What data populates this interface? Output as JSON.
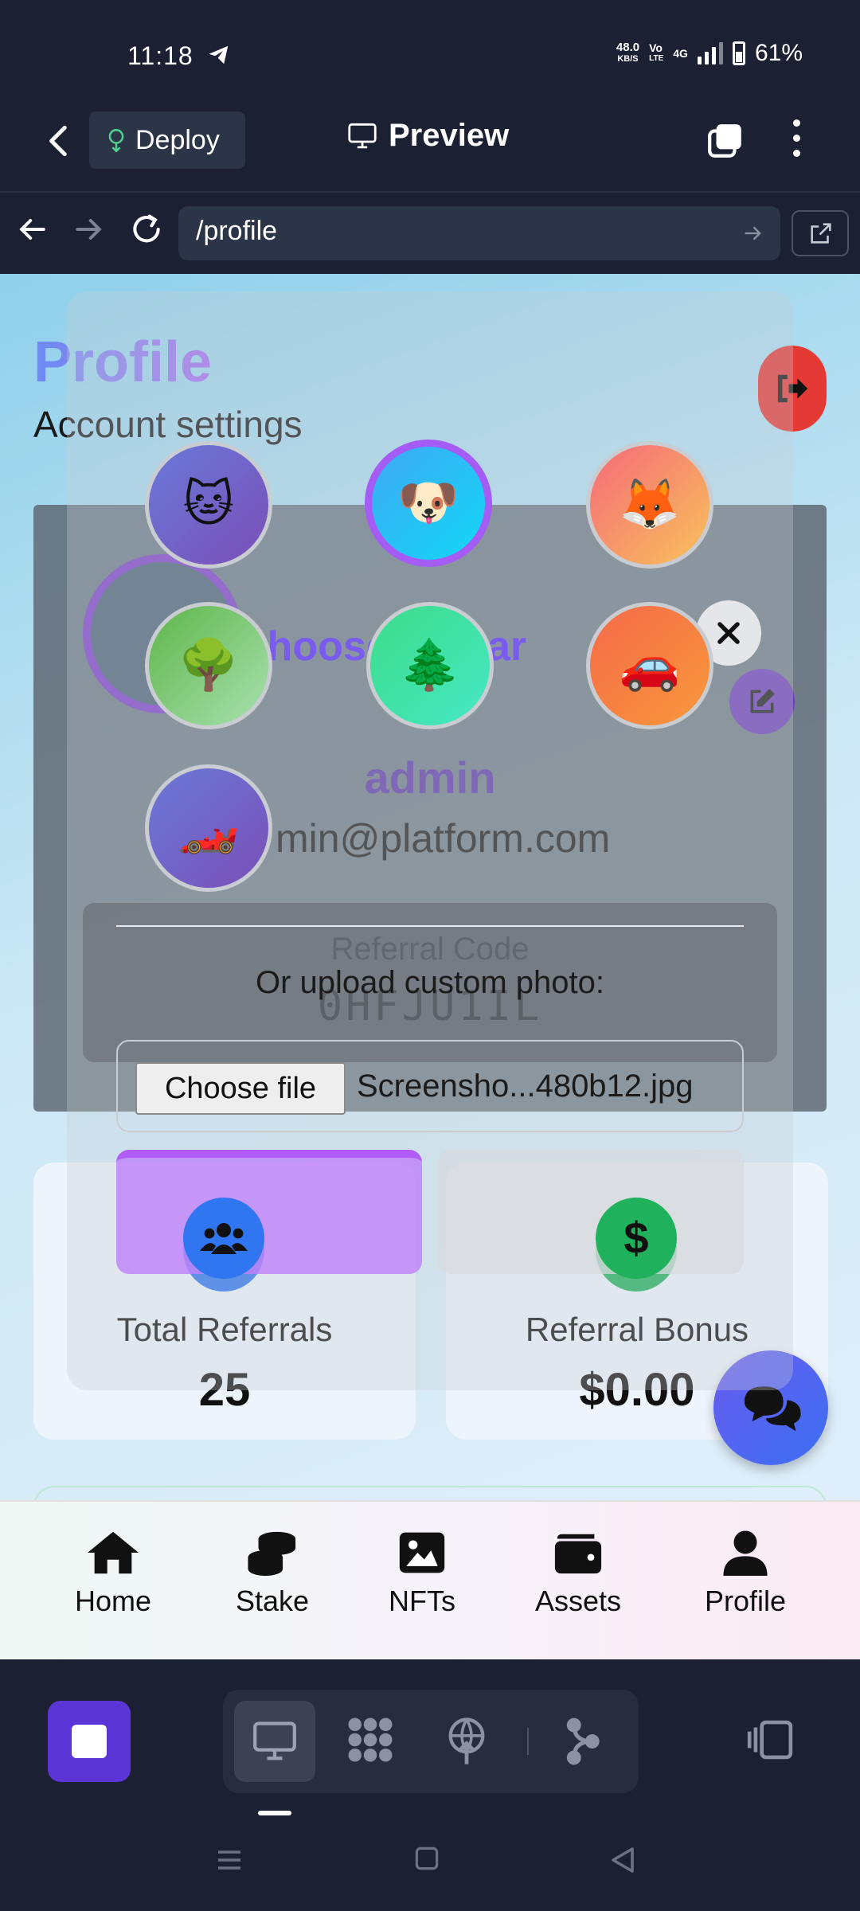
{
  "status_bar": {
    "time": "11:18",
    "net_speed_value": "48.0",
    "net_speed_unit": "KB/S",
    "volte_top": "Vo",
    "volte_bottom": "LTE",
    "signal_label": "4G",
    "battery_percent": "61%",
    "battery_level": 0.61
  },
  "app_header": {
    "deploy_label": "Deploy",
    "preview_label": "Preview"
  },
  "url_bar": {
    "url": "/profile"
  },
  "page": {
    "title": "Profile",
    "subtitle": "Account settings",
    "username": "admin",
    "email": "min@platform.com",
    "referral_label": "Referral Code",
    "referral_code": "0HFJU1IL",
    "stats": [
      {
        "label": "Total Referrals",
        "value": "25",
        "icon": "users-icon"
      },
      {
        "label": "Referral Bonus",
        "value": "$0.00",
        "icon": "dollar-icon"
      }
    ],
    "dollar_glyph": "$"
  },
  "modal": {
    "title": "Choose Avatar",
    "avatars": [
      {
        "emoji": "🐱",
        "name": "cat",
        "selected": false
      },
      {
        "emoji": "🐶",
        "name": "dog",
        "selected": true
      },
      {
        "emoji": "🦊",
        "name": "fox",
        "selected": false
      },
      {
        "emoji": "🌳",
        "name": "tree",
        "selected": false
      },
      {
        "emoji": "🌲",
        "name": "evergreen",
        "selected": false
      },
      {
        "emoji": "🚗",
        "name": "car",
        "selected": false
      },
      {
        "emoji": "🏎️",
        "name": "race-car",
        "selected": false
      }
    ],
    "upload_label": "Or upload custom photo:",
    "file_button": "Choose file",
    "file_name": "Screensho...480b12.jpg"
  },
  "bottom_nav": {
    "items": [
      {
        "label": "Home",
        "icon": "home-icon"
      },
      {
        "label": "Stake",
        "icon": "coins-icon"
      },
      {
        "label": "NFTs",
        "icon": "image-icon"
      },
      {
        "label": "Assets",
        "icon": "wallet-icon"
      },
      {
        "label": "Profile",
        "icon": "user-icon"
      }
    ]
  },
  "colors": {
    "accent_purple": "#7a5bf0",
    "logout_red": "#e53935",
    "ide_bg": "#1b2133",
    "stop_button": "#5b35d5"
  }
}
